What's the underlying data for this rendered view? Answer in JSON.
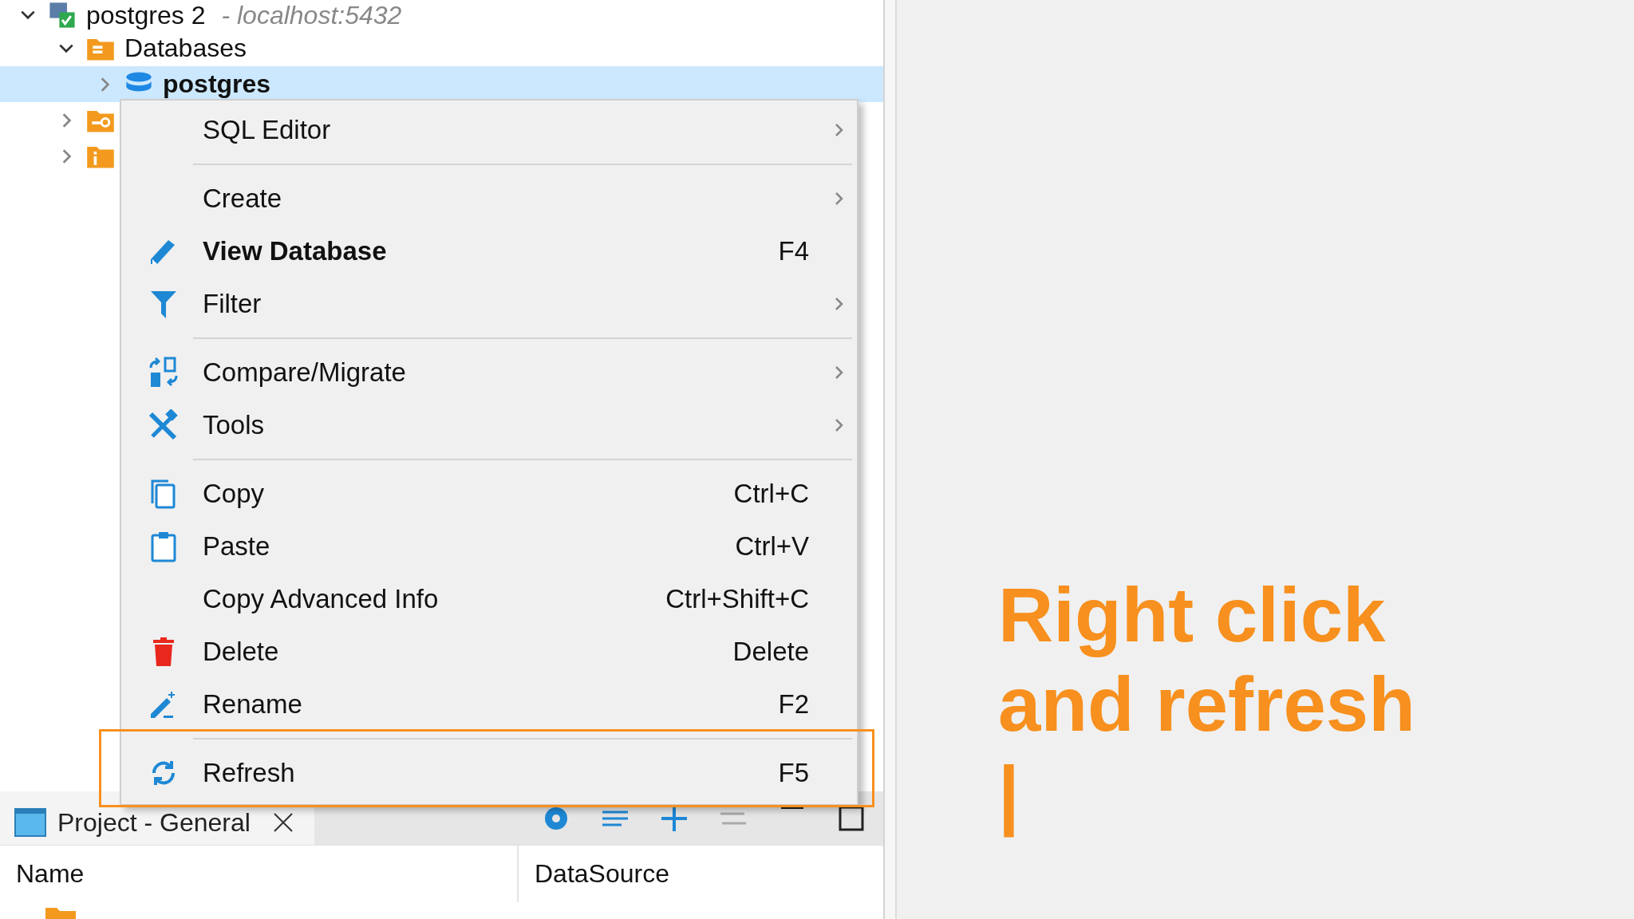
{
  "tree": [
    {
      "label": "postgres 2",
      "detail": "- localhost:5432",
      "kind": "connection",
      "expanded": true,
      "selected": false,
      "children": [
        {
          "label": "Databases",
          "kind": "folder",
          "expanded": true,
          "selected": false,
          "children": [
            {
              "label": "postgres",
              "kind": "database",
              "expanded": false,
              "selected": true
            }
          ]
        },
        {
          "kind": "link-folder",
          "expanded": false,
          "selected": false
        },
        {
          "kind": "info-folder",
          "expanded": false,
          "selected": false
        }
      ]
    }
  ],
  "context_menu": {
    "groups": [
      [
        {
          "label": "SQL Editor",
          "submenu": true
        }
      ],
      [
        {
          "label": "Create",
          "submenu": true
        },
        {
          "label": "View Database",
          "shortcut": "F4",
          "default": true
        },
        {
          "label": "Filter",
          "submenu": true
        }
      ],
      [
        {
          "label": "Compare/Migrate",
          "submenu": true
        },
        {
          "label": "Tools",
          "submenu": true
        }
      ],
      [
        {
          "label": "Copy",
          "shortcut": "Ctrl+C"
        },
        {
          "label": "Paste",
          "shortcut": "Ctrl+V"
        },
        {
          "label": "Copy Advanced Info",
          "shortcut": "Ctrl+Shift+C"
        },
        {
          "label": "Delete",
          "shortcut": "Delete"
        },
        {
          "label": "Rename",
          "shortcut": "F2"
        }
      ],
      [
        {
          "label": "Refresh",
          "shortcut": "F5",
          "annotated": true
        }
      ]
    ]
  },
  "project_panel": {
    "tab": {
      "label": "Project - General",
      "selected": true
    },
    "columns": [
      "Name",
      "DataSource"
    ]
  },
  "annotation": {
    "lines": [
      "Right click",
      "and refresh",
      "|"
    ]
  }
}
